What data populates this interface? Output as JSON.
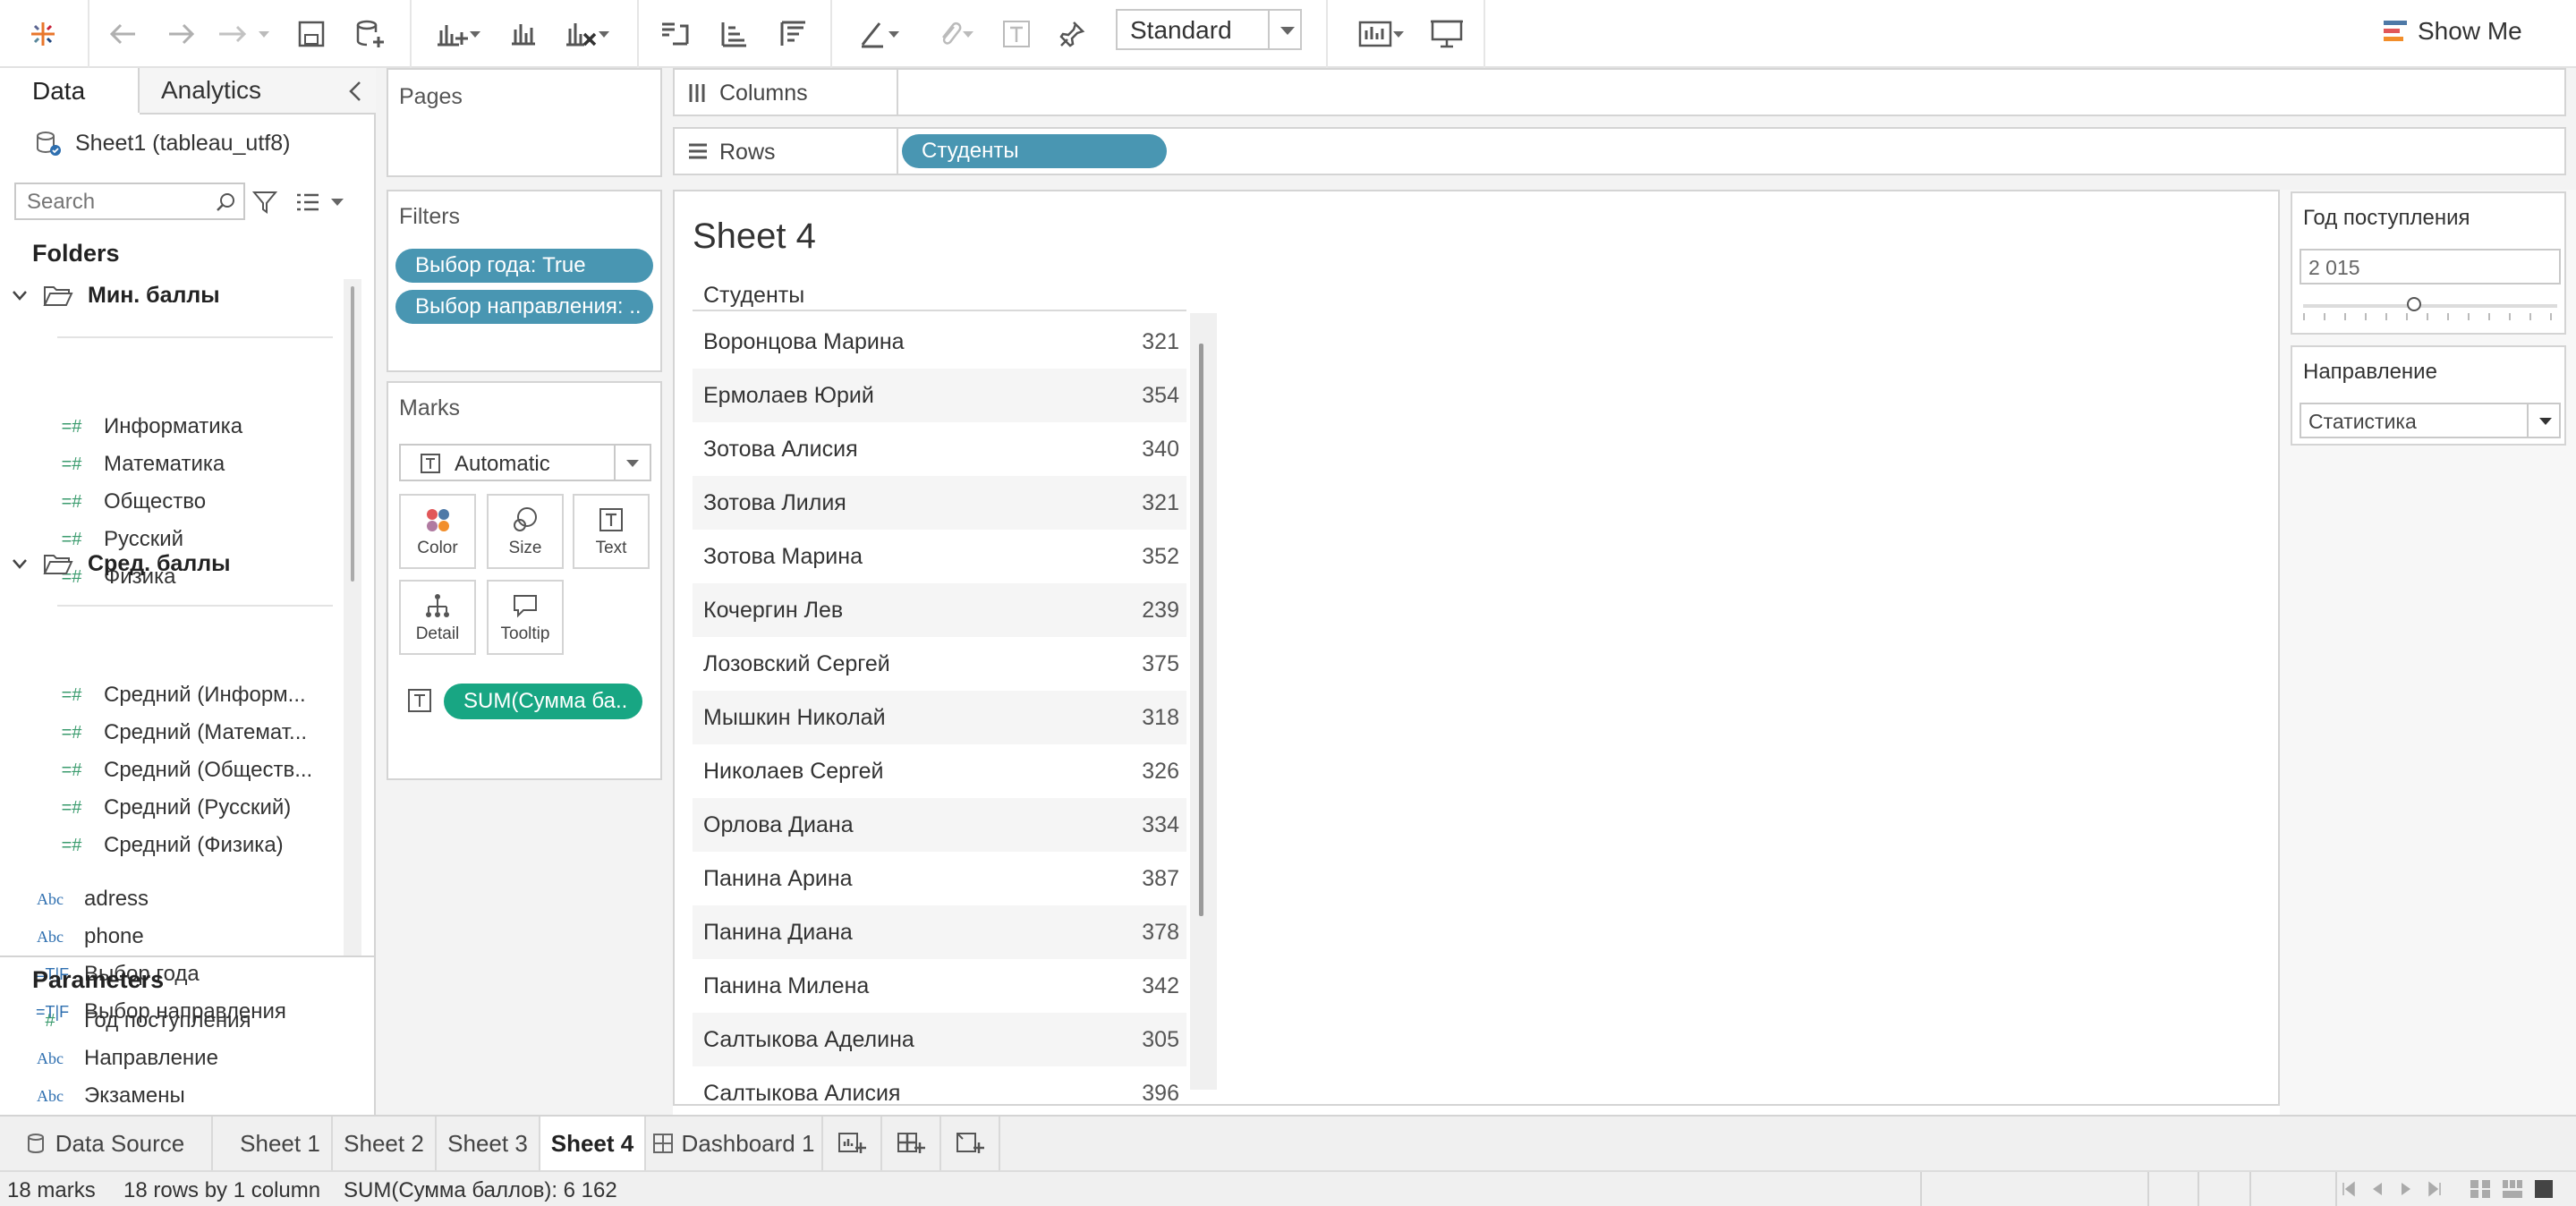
{
  "toolbar": {
    "view_mode": "Standard",
    "show_me": "Show Me"
  },
  "data_pane": {
    "tab_data": "Data",
    "tab_analytics": "Analytics",
    "datasource": "Sheet1 (tableau_utf8)",
    "search_placeholder": "Search",
    "folders_heading": "Folders",
    "folder1": {
      "name": "Мин. баллы",
      "fields": [
        "Информатика",
        "Математика",
        "Общество",
        "Русский",
        "Физика"
      ]
    },
    "folder2": {
      "name": "Сред. баллы",
      "fields": [
        "Средний (Информ...",
        "Средний (Математ...",
        "Средний (Обществ...",
        "Средний (Русский)",
        "Средний (Физика)"
      ]
    },
    "other_fields": [
      {
        "icon": "Abc",
        "name": "adress"
      },
      {
        "icon": "Abc",
        "name": "phone"
      },
      {
        "icon": "=T|F",
        "name": "Выбор года"
      },
      {
        "icon": "=T|F",
        "name": "Выбор направления"
      }
    ],
    "parameters_heading": "Parameters",
    "parameters": [
      {
        "icon": "#",
        "name": "Год поступления"
      },
      {
        "icon": "Abc",
        "name": "Направление"
      },
      {
        "icon": "Abc",
        "name": "Экзамены"
      }
    ]
  },
  "pages": {
    "title": "Pages"
  },
  "filters": {
    "title": "Filters",
    "pills": [
      "Выбор года: True",
      "Выбор направления: .."
    ]
  },
  "marks": {
    "title": "Marks",
    "type": "Automatic",
    "buttons": [
      "Color",
      "Size",
      "Text",
      "Detail",
      "Tooltip"
    ],
    "pill": "SUM(Сумма ба.."
  },
  "shelves": {
    "columns_label": "Columns",
    "rows_label": "Rows",
    "rows_pill": "Студенты"
  },
  "view": {
    "title": "Sheet 4",
    "column_header": "Студенты",
    "rows": [
      {
        "name": "Воронцова Марина",
        "value": "321"
      },
      {
        "name": "Ермолаев Юрий",
        "value": "354"
      },
      {
        "name": "Зотова Алисия",
        "value": "340"
      },
      {
        "name": "Зотова Лилия",
        "value": "321"
      },
      {
        "name": "Зотова Марина",
        "value": "352"
      },
      {
        "name": "Кочергин Лев",
        "value": "239"
      },
      {
        "name": "Лозовский Сергей",
        "value": "375"
      },
      {
        "name": "Мышкин Николай",
        "value": "318"
      },
      {
        "name": "Николаев Сергей",
        "value": "326"
      },
      {
        "name": "Орлова Диана",
        "value": "334"
      },
      {
        "name": "Панина Арина",
        "value": "387"
      },
      {
        "name": "Панина Диана",
        "value": "378"
      },
      {
        "name": "Панина Милена",
        "value": "342"
      },
      {
        "name": "Салтыкова Аделина",
        "value": "305"
      },
      {
        "name": "Салтыкова Алисия",
        "value": "396"
      }
    ]
  },
  "param_controls": {
    "year": {
      "title": "Год поступления",
      "value": "2 015"
    },
    "direction": {
      "title": "Направление",
      "value": "Статистика"
    }
  },
  "sheet_tabs": {
    "data_source": "Data Source",
    "tabs": [
      "Sheet 1",
      "Sheet 2",
      "Sheet 3",
      "Sheet 4",
      "Dashboard 1"
    ],
    "active": "Sheet 4"
  },
  "status": {
    "marks": "18 marks",
    "dims": "18 rows by 1 column",
    "sum": "SUM(Сумма баллов): 6 162"
  },
  "colors": {
    "pill_blue": "#4996b2",
    "pill_green": "#18a683",
    "tableau_brand": "#e8762b"
  }
}
